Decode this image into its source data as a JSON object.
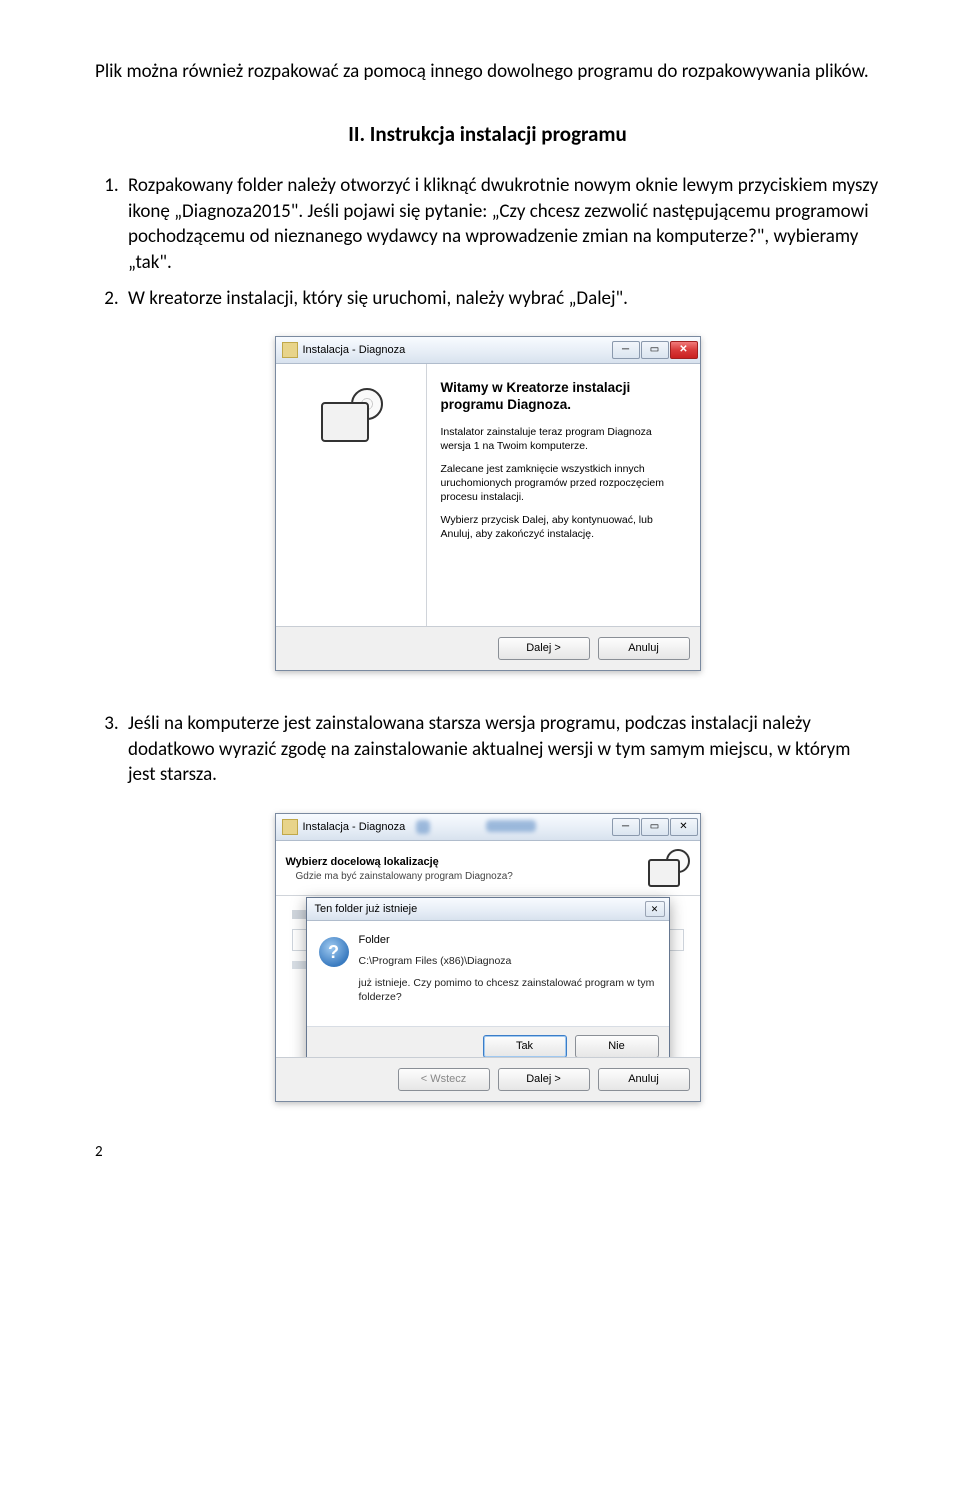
{
  "intro": "Plik można również rozpakować za pomocą innego dowolnego programu do rozpakowywania plików.",
  "section_title": "II. Instrukcja instalacji programu",
  "steps": {
    "s1": "Rozpakowany folder należy otworzyć i kliknąć dwukrotnie nowym oknie lewym przyciskiem myszy ikonę „Diagnoza2015\". Jeśli pojawi się pytanie: „Czy chcesz zezwolić następującemu programowi pochodzącemu od nieznanego wydawcy na wprowadzenie zmian na komputerze?\", wybieramy „tak\".",
    "s2": "W kreatorze instalacji, który się uruchomi, należy wybrać „Dalej\".",
    "s3": "Jeśli na komputerze jest zainstalowana starsza wersja programu, podczas instalacji należy dodatkowo wyrazić zgodę na zainstalowanie aktualnej wersji w tym samym miejscu, w którym jest starsza."
  },
  "win1": {
    "title": "Instalacja - Diagnoza",
    "heading": "Witamy w Kreatorze instalacji programu Diagnoza.",
    "p1": "Instalator zainstaluje teraz program Diagnoza wersja 1 na Twoim komputerze.",
    "p2": "Zalecane jest zamknięcie wszystkich innych uruchomionych programów przed rozpoczęciem procesu instalacji.",
    "p3": "Wybierz przycisk Dalej, aby kontynuować, lub Anuluj, aby zakończyć instalację.",
    "btn_next": "Dalej >",
    "btn_cancel": "Anuluj"
  },
  "win2": {
    "title": "Instalacja - Diagnoza",
    "head1": "Wybierz docelową lokalizację",
    "head2": "Gdzie ma być zainstalowany program Diagnoza?",
    "btn_back": "< Wstecz",
    "btn_next": "Dalej >",
    "btn_cancel": "Anuluj"
  },
  "dialog": {
    "title": "Ten folder już istnieje",
    "hd": "Folder",
    "path": "C:\\Program Files (x86)\\Diagnoza",
    "q": "już istnieje. Czy pomimo to chcesz zainstalować program w tym folderze?",
    "yes": "Tak",
    "no": "Nie"
  },
  "page_number": "2"
}
